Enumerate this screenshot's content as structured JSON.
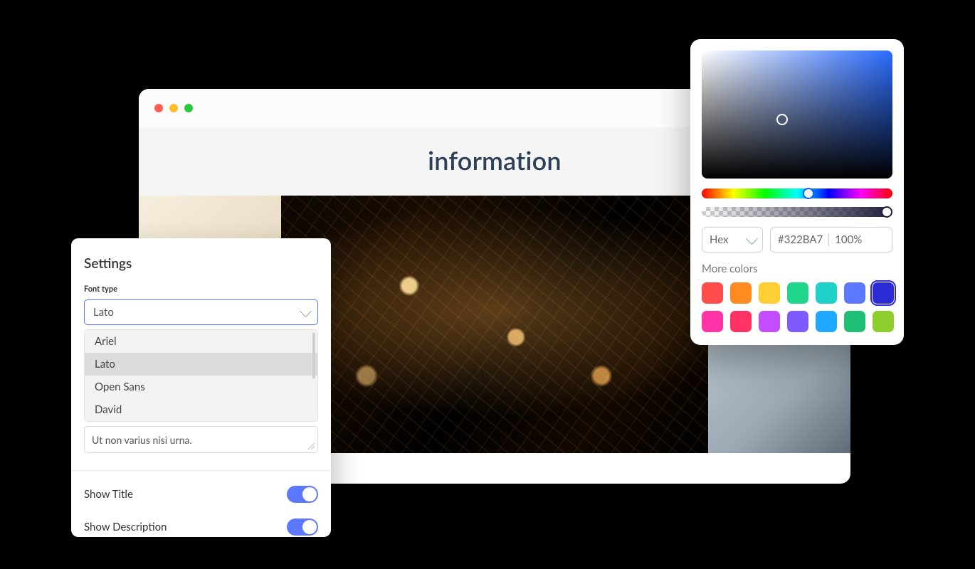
{
  "main": {
    "title": "information"
  },
  "settings": {
    "heading": "Settings",
    "font_label": "Font type",
    "font_value": "Lato",
    "font_options": [
      "Ariel",
      "Lato",
      "Open Sans",
      "David"
    ],
    "textarea_value": "Ut non varius nisi urna.",
    "toggles": [
      {
        "label": "Show Title",
        "on": true
      },
      {
        "label": "Show Description",
        "on": true
      }
    ]
  },
  "picker": {
    "format_label": "Hex",
    "hex_value": "#322BA7",
    "alpha_value": "100%",
    "more_label": "More colors",
    "swatches": [
      "#ff4d4d",
      "#ff8a1f",
      "#ffcf33",
      "#1fd68a",
      "#1fd1c6",
      "#5b78ff",
      "#2b2bd6",
      "#ff33a8",
      "#ff3366",
      "#c44dff",
      "#7d5bff",
      "#1fa9ff",
      "#1fbf75",
      "#8ecf2f"
    ],
    "selected_index": 6
  }
}
